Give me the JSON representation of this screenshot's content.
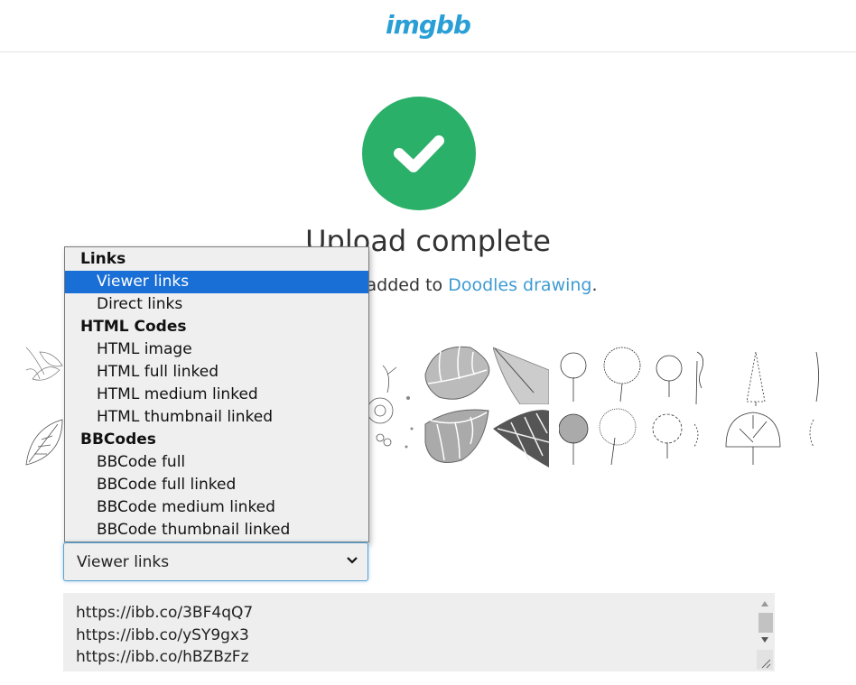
{
  "header": {
    "logo": "imgbb"
  },
  "status": {
    "icon": "check-circle-icon",
    "title": "Upload complete",
    "subtitle_prefix": "nt added to ",
    "album_link": "Doodles drawing",
    "subtitle_suffix": "."
  },
  "colors": {
    "brand": "#2a9fd6",
    "success": "#2bb06a",
    "link": "#3e9bd3",
    "selected_option": "#1a6fd6"
  },
  "thumbnails": [
    {
      "name": "leaves-sketch-1"
    },
    {
      "name": "leaves-sketch-2"
    },
    {
      "name": "flower-sketch"
    },
    {
      "name": "leaf-pattern-1"
    },
    {
      "name": "leaf-pattern-2"
    },
    {
      "name": "fern-leaf"
    },
    {
      "name": "dark-leaf"
    },
    {
      "name": "tree-sketches"
    }
  ],
  "embed_select": {
    "value": "Viewer links",
    "groups": [
      {
        "label": "Links",
        "options": [
          "Viewer links",
          "Direct links"
        ]
      },
      {
        "label": "HTML Codes",
        "options": [
          "HTML image",
          "HTML full linked",
          "HTML medium linked",
          "HTML thumbnail linked"
        ]
      },
      {
        "label": "BBCodes",
        "options": [
          "BBCode full",
          "BBCode full linked",
          "BBCode medium linked",
          "BBCode thumbnail linked"
        ]
      }
    ],
    "selected_option": "Viewer links"
  },
  "links_textarea": {
    "lines": [
      "https://ibb.co/3BF4qQ7",
      "https://ibb.co/ySY9gx3",
      "https://ibb.co/hBZBzFz"
    ]
  }
}
